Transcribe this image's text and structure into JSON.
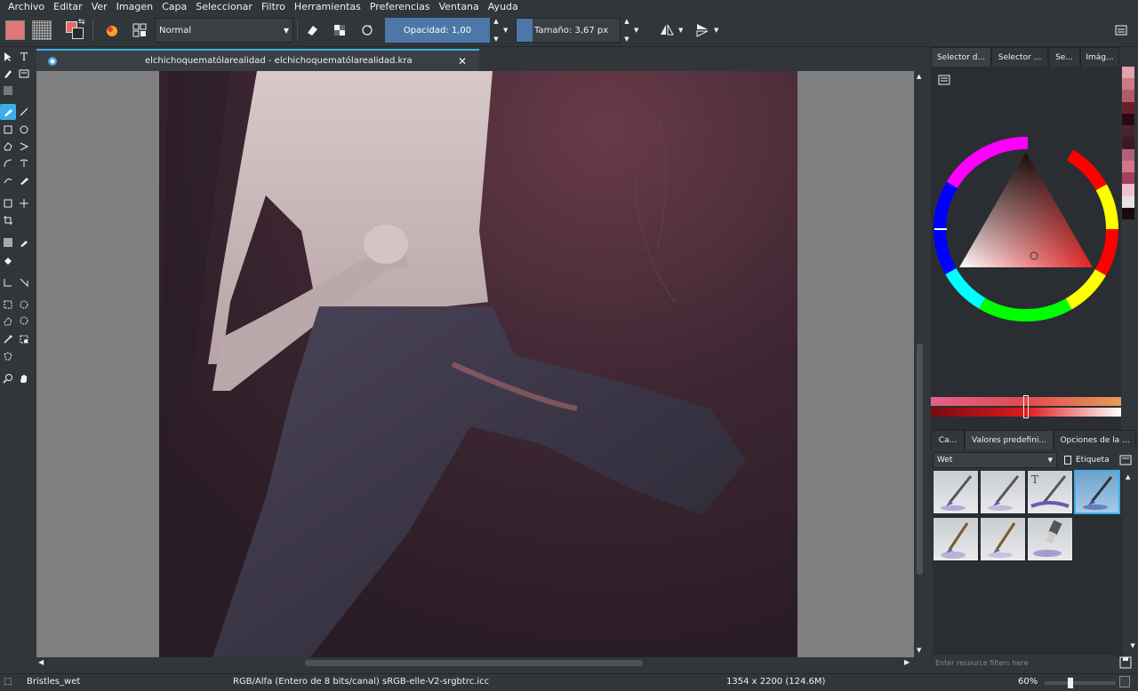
{
  "menubar": {
    "items": [
      "Archivo",
      "Editar",
      "Ver",
      "Imagen",
      "Capa",
      "Seleccionar",
      "Filtro",
      "Herramientas",
      "Preferencias",
      "Ventana",
      "Ayuda"
    ]
  },
  "toolbar": {
    "blend_mode": "Normal",
    "opacity_label": "Opacidad:  1,00",
    "size_label": "Tamaño:  3,67 px",
    "foreground_color": "#e36a6a",
    "background_color": "#2b2b2b"
  },
  "document": {
    "tab_title": "elchichoquematólarealidad - elchichoquematólarealidad.kra"
  },
  "dock": {
    "top_tabs": [
      "Selector d...",
      "Selector ...",
      "Se...",
      "Imág..."
    ],
    "bottom_tabs": [
      "Ca...",
      "Valores predefini...",
      "Opciones de la ..."
    ],
    "preset_filter": "Wet",
    "tag_label": "Etiqueta",
    "filter_placeholder": "Enter resource filters here",
    "history_colors": [
      "#e4a2aa",
      "#cc7a86",
      "#b35a68",
      "#6a1e2b",
      "#2a0a10",
      "#4a2330",
      "#3a1a24",
      "#b0607a",
      "#d4738a",
      "#a04060",
      "#f0c0c8",
      "#e8e0e0",
      "#1a0a0d"
    ],
    "accent_colors": {
      "hue_ring_selected": "#ff0000",
      "triangle_hue": "#e52424"
    }
  },
  "statusbar": {
    "brush_name": "Bristles_wet",
    "color_profile": "RGB/Alfa (Entero de 8 bits/canal)  sRGB-elle-V2-srgbtrc.icc",
    "image_size": "1354 x 2200 (124.6M)",
    "zoom": "60%"
  }
}
